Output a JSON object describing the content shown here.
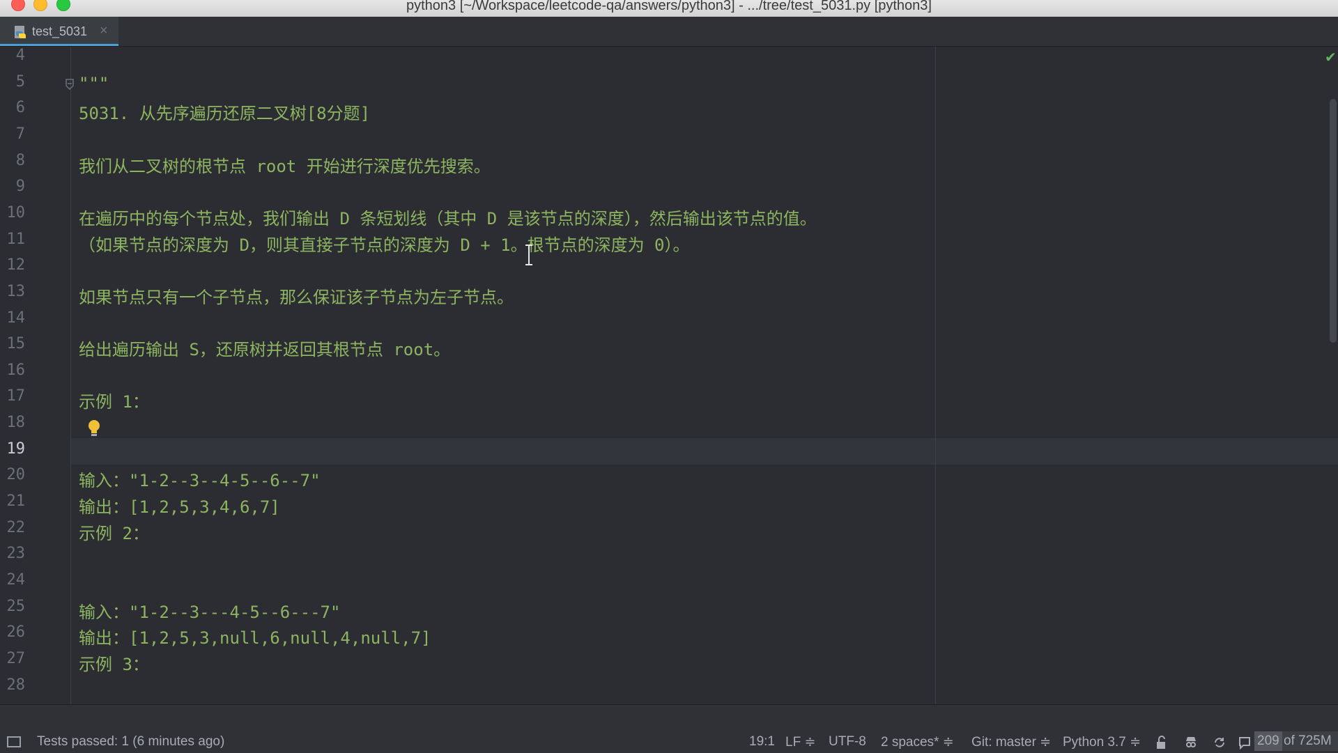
{
  "window": {
    "title": "python3 [~/Workspace/leetcode-qa/answers/python3] - .../tree/test_5031.py [python3]"
  },
  "tabs": [
    {
      "label": "test_5031",
      "icon": "python-file-icon",
      "active": true
    }
  ],
  "editor": {
    "line_numbers": [
      "4",
      "5",
      "6",
      "7",
      "8",
      "9",
      "10",
      "11",
      "12",
      "13",
      "14",
      "15",
      "16",
      "17",
      "18",
      "19",
      "20",
      "21",
      "22",
      "23",
      "24",
      "25",
      "26",
      "27",
      "28"
    ],
    "current_line": "19",
    "lines": [
      "",
      "\"\"\"",
      "5031. 从先序遍历还原二叉树[8分题]",
      "",
      "我们从二叉树的根节点 root 开始进行深度优先搜索。",
      "",
      "在遍历中的每个节点处，我们输出 D 条短划线（其中 D 是该节点的深度），然后输出该节点的值。",
      "（如果节点的深度为 D，则其直接子节点的深度为 D + 1。根节点的深度为 0）。",
      "",
      "如果节点只有一个子节点，那么保证该子节点为左子节点。",
      "",
      "给出遍历输出 S，还原树并返回其根节点 root。",
      "",
      "示例 1：",
      "",
      "",
      "输入：\"1-2--3--4-5--6--7\"",
      "输出：[1,2,5,3,4,6,7]",
      "示例 2：",
      "",
      "",
      "输入：\"1-2--3---4-5--6---7\"",
      "输出：[1,2,5,3,null,6,null,4,null,7]",
      "示例 3：",
      ""
    ],
    "colors": {
      "background": "#2b2d33",
      "docstring": "#8db55f",
      "line_number": "#6c7079"
    }
  },
  "statusbar": {
    "message": "Tests passed: 1 (6 minutes ago)",
    "position": "19:1",
    "line_separator": "LF ≑",
    "encoding": "UTF-8",
    "indent": "2 spaces* ≑",
    "vcs": "Git: master ≑",
    "interpreter": "Python 3.7 ≑",
    "memory_used": "209",
    "memory_total": "of 725M"
  }
}
